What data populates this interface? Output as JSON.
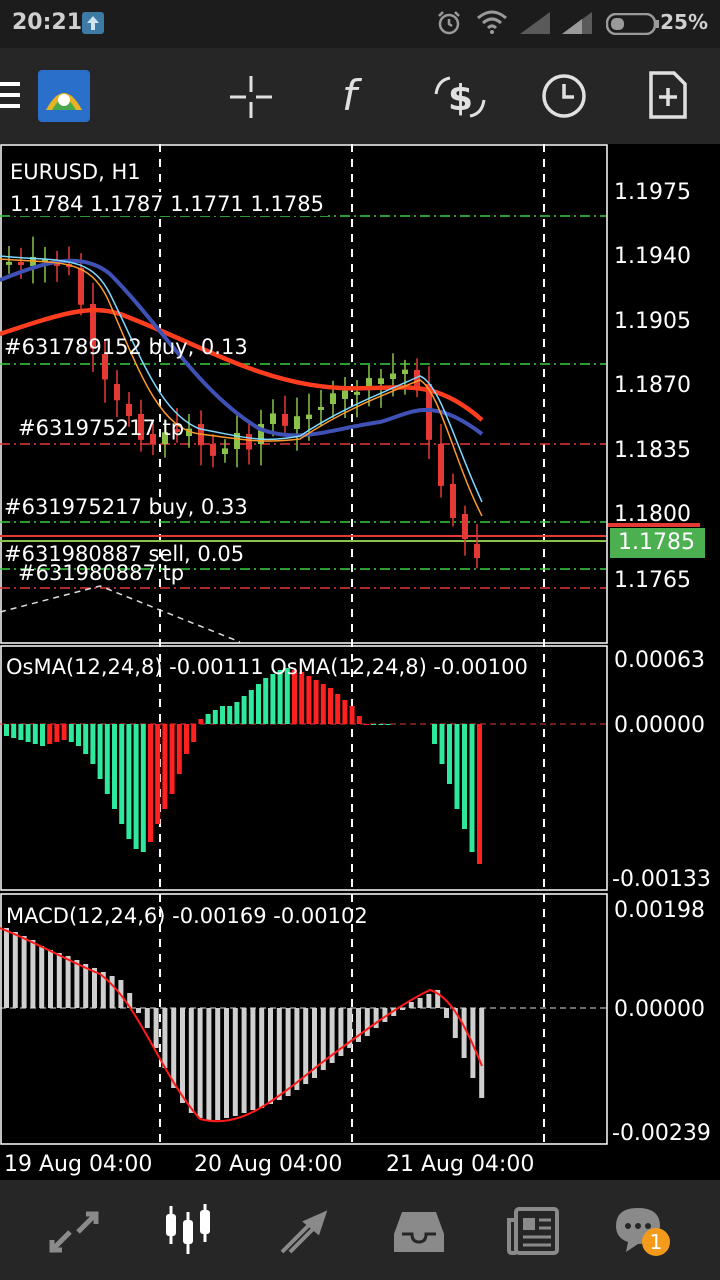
{
  "status_bar": {
    "time": "20:21",
    "battery": "25%",
    "icons": [
      "upload-notification-icon",
      "alarm-icon",
      "wifi-icon",
      "signal-icon",
      "signal-icon",
      "battery-icon"
    ]
  },
  "toolbar": {
    "icons": [
      "menu-icon",
      "metatrader-logo-icon",
      "crosshair-icon",
      "indicators-f-icon",
      "trade-icon",
      "timeframe-clock-icon",
      "new-order-icon"
    ]
  },
  "main_chart": {
    "symbol": "EURUSD, H1",
    "ohlc": "1.1784 1.1787 1.1771 1.1785",
    "price_labels": [
      "1.1975",
      "1.1940",
      "1.1905",
      "1.1870",
      "1.1835",
      "1.1800",
      "1.1765"
    ],
    "current_price": "1.1785",
    "orders": [
      {
        "text": "#631789152 buy, 0.13"
      },
      {
        "text": "#631975217 tp"
      },
      {
        "text": "#631975217 buy, 0.33"
      },
      {
        "text": "#631980887 sell, 0.05"
      },
      {
        "text": "#631980887 tp"
      }
    ]
  },
  "osma_panel": {
    "title": "OsMA(12,24,8) -0.00111 OsMA(12,24,8) -0.00100",
    "axis": [
      "0.00063",
      "0.00000",
      "-0.00133"
    ]
  },
  "macd_panel": {
    "title": "MACD(12,24,6) -0.00169 -0.00102",
    "axis": [
      "0.00198",
      "0.00000",
      "-0.00239"
    ]
  },
  "time_axis": [
    "19 Aug 04:00",
    "20 Aug 04:00",
    "21 Aug 04:00"
  ],
  "bottom_nav": {
    "items": [
      "quotes-icon",
      "charts-icon",
      "trade-icon",
      "history-icon",
      "news-icon",
      "messages-icon"
    ],
    "messages_badge": "1"
  },
  "colors": {
    "bull": "#8bc34a",
    "bear": "#e53935",
    "ma_fast": "#3f51b5",
    "ma_slow": "#ff3d1f",
    "osma_up": "#2ee89c",
    "osma_down": "#ff2020",
    "current_price_bg": "#4caf50"
  }
}
